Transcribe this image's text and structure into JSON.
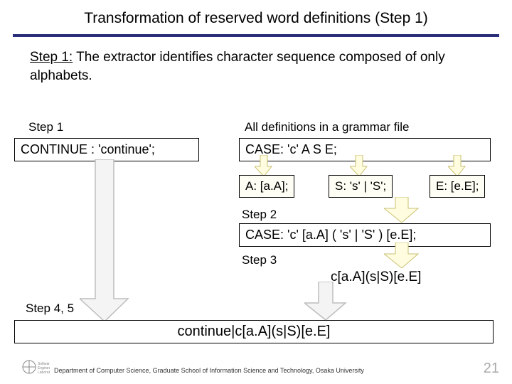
{
  "title": "Transformation of reserved word definitions (Step 1)",
  "subtitle_step": "Step 1:",
  "subtitle_rest": " The extractor identifies character sequence composed of only alphabets.",
  "labels": {
    "step1": "Step 1",
    "allDefs": "All definitions in a grammar file",
    "step2": "Step 2",
    "step3": "Step 3",
    "step45": "Step 4, 5"
  },
  "box": {
    "continue": "CONTINUE : 'continue';",
    "case1": "CASE: 'c' A S E;",
    "A": "A: [a.A];",
    "S": "S: 's' | 'S';",
    "E": "E: [e.E];",
    "case2": "CASE: 'c' [a.A] ( 's' | 'S' ) [e.E];"
  },
  "regex": {
    "step3": "c[a.A](s|S)[e.E]",
    "final": "continue|c[a.A](s|S)[e.E]"
  },
  "footer": "Department of Computer Science, Graduate School of Information Science and Technology, Osaka University",
  "page": "21"
}
